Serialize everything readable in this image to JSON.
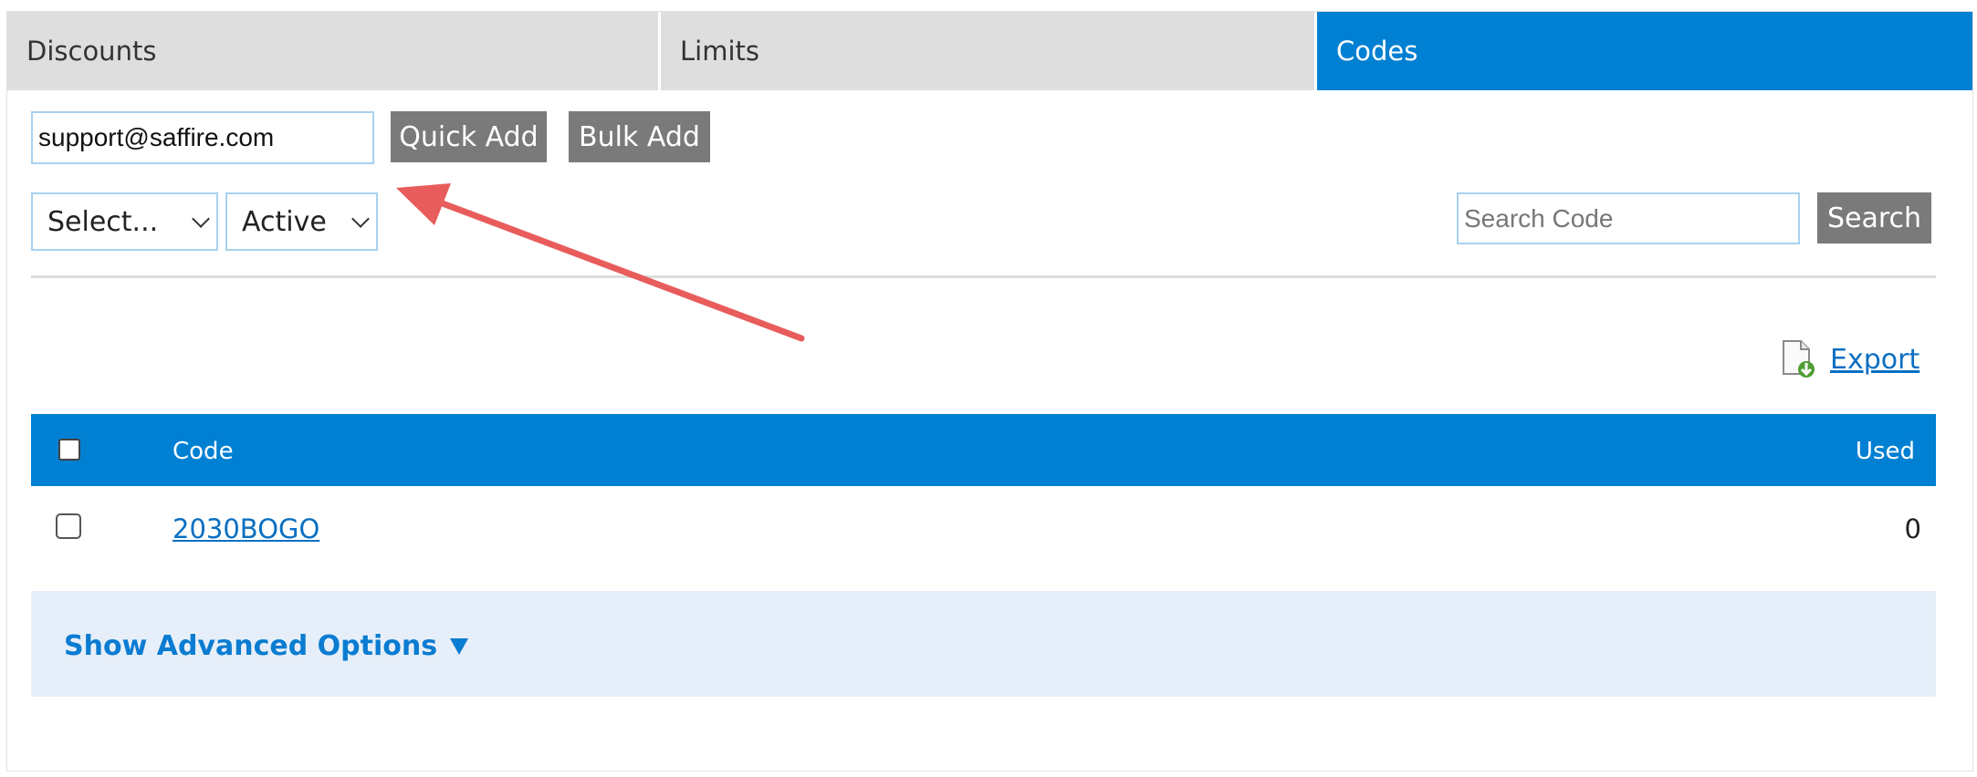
{
  "tabs": [
    {
      "label": "Discounts",
      "active": false
    },
    {
      "label": "Limits",
      "active": false
    },
    {
      "label": "Codes",
      "active": true
    }
  ],
  "quick_add": {
    "input_value": "support@saffire.com",
    "quick_add_label": "Quick Add",
    "bulk_add_label": "Bulk Add"
  },
  "filters": {
    "type_select": "Select...",
    "status_select": "Active"
  },
  "search": {
    "placeholder": "Search Code",
    "button_label": "Search"
  },
  "export": {
    "label": "Export",
    "icon": "export-document-icon"
  },
  "table": {
    "columns": [
      "Code",
      "Used"
    ],
    "rows": [
      {
        "code": "2030BOGO",
        "used": "0"
      }
    ]
  },
  "advanced": {
    "label": "Show Advanced Options"
  },
  "colors": {
    "accent": "#0080d2",
    "button_gray": "#7a7a7a",
    "annotation_arrow": "#e85c5c",
    "advanced_bg": "#e6eff9"
  }
}
